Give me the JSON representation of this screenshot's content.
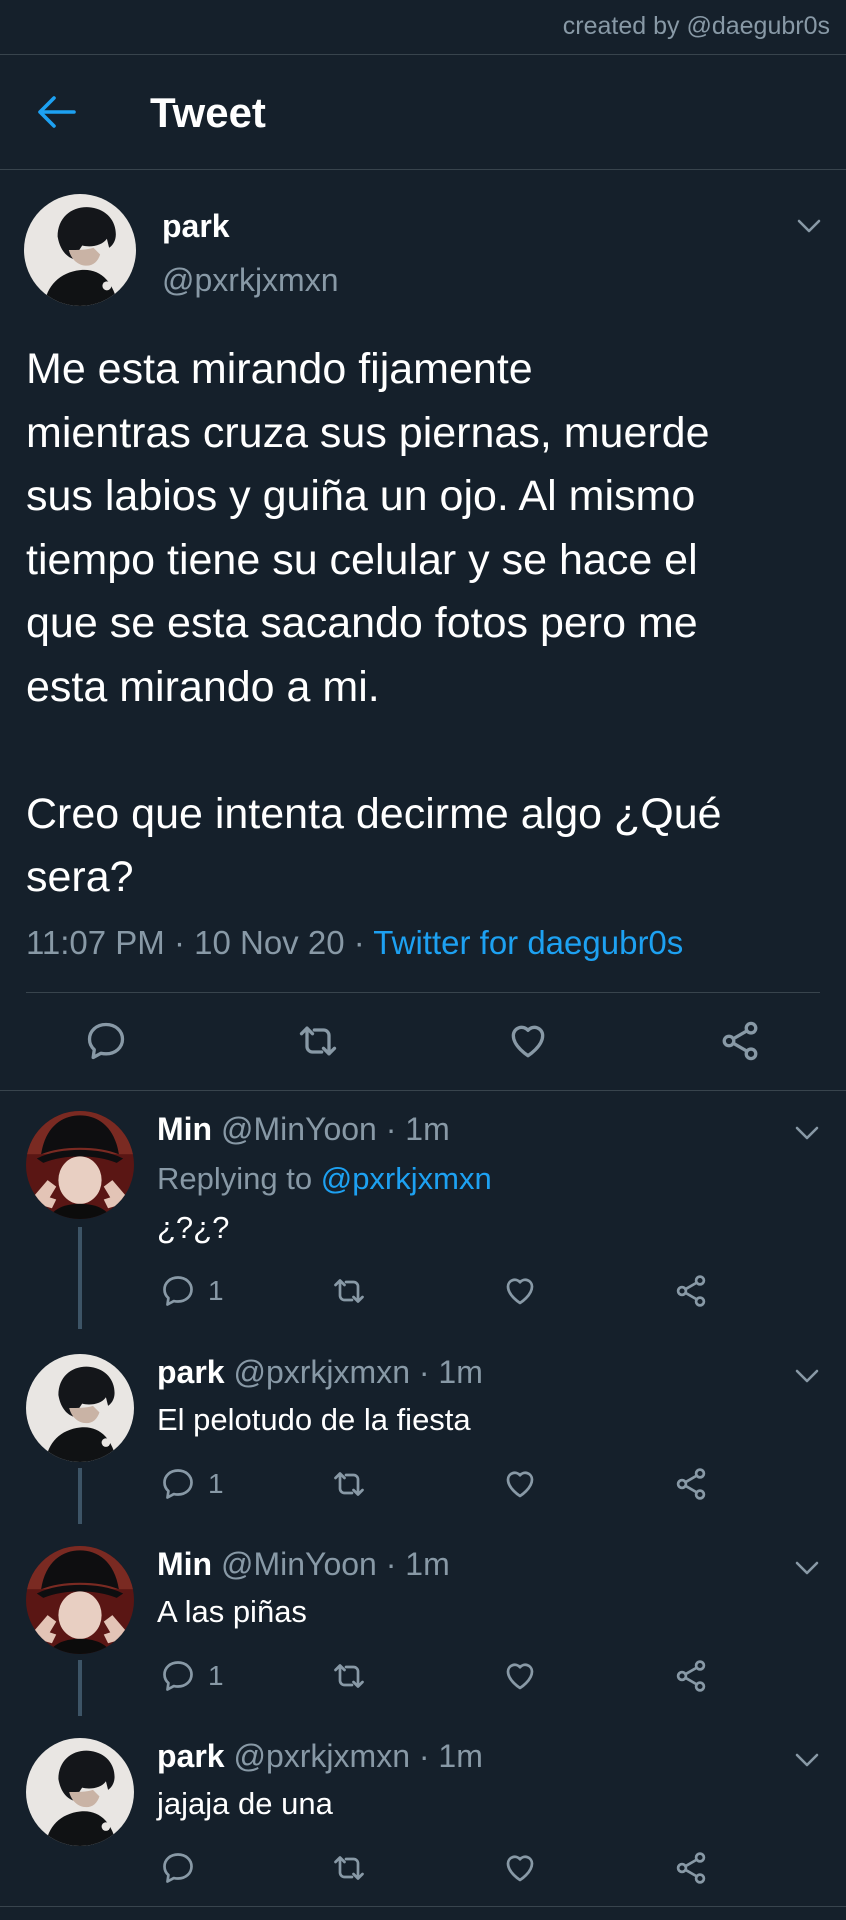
{
  "credit": "created by @daegubr0s",
  "header": {
    "title": "Tweet"
  },
  "tweet": {
    "name": "park",
    "handle": "@pxrkjxmxn",
    "text": "Me esta mirando fijamente\nmientras cruza sus piernas, muerde\nsus labios y guiña un ojo. Al mismo\ntiempo tiene su celular y se hace el\nque se esta sacando fotos pero me\nesta mirando a mi.\n\nCreo que intenta decirme algo ¿Qué\nsera?",
    "time": "11:07 PM · 10 Nov 20 · ",
    "source": "Twitter for daegubr0s"
  },
  "replies": [
    {
      "name": "Min",
      "meta": "@MinYoon · 1m",
      "replying_label": "Replying to ",
      "replying_to": "@pxrkjxmxn",
      "text": "¿?¿?",
      "reply_count": "1"
    },
    {
      "name": "park",
      "meta": "@pxrkjxmxn · 1m",
      "text": "El pelotudo de la fiesta",
      "reply_count": "1"
    },
    {
      "name": "Min",
      "meta": "@MinYoon · 1m",
      "text": "A las piñas",
      "reply_count": "1"
    },
    {
      "name": "park",
      "meta": "@pxrkjxmxn · 1m",
      "text": "jajaja de una",
      "reply_count": ""
    }
  ],
  "colors": {
    "background": "#15202b",
    "accent": "#1da1f2",
    "secondary_text": "#8899a6",
    "divider": "#38444d"
  },
  "icons": [
    "back-arrow-icon",
    "chevron-down-icon",
    "reply-icon",
    "retweet-icon",
    "like-icon",
    "share-icon"
  ]
}
